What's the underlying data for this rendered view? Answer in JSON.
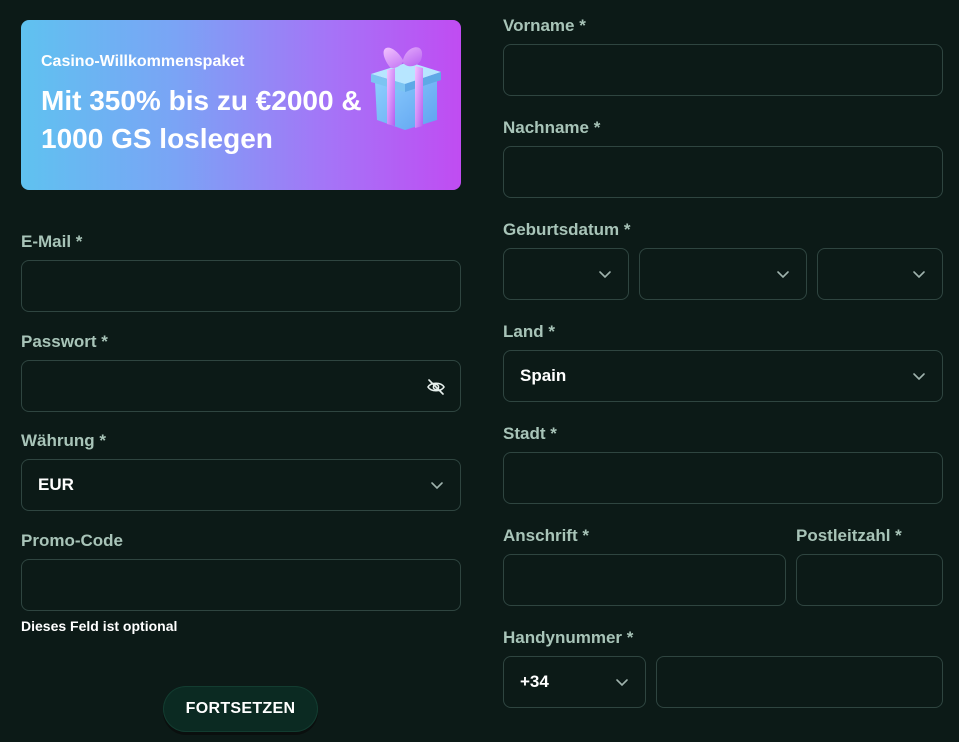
{
  "banner": {
    "subtitle": "Casino-Willkommenspaket",
    "title": "Mit 350% bis zu €2000 & 1000 GS loslegen"
  },
  "left": {
    "email_label": "E-Mail *",
    "email_value": "",
    "password_label": "Passwort *",
    "password_value": "",
    "currency_label": "Währung *",
    "currency_value": "EUR",
    "promo_label": "Promo-Code",
    "promo_value": "",
    "promo_hint": "Dieses Feld ist optional",
    "submit_label": "FORTSETZEN"
  },
  "right": {
    "firstname_label": "Vorname *",
    "firstname_value": "",
    "lastname_label": "Nachname *",
    "lastname_value": "",
    "birthdate_label": "Geburtsdatum *",
    "birthdate_day": "",
    "birthdate_month": "",
    "birthdate_year": "",
    "country_label": "Land *",
    "country_value": "Spain",
    "city_label": "Stadt *",
    "city_value": "",
    "address_label": "Anschrift *",
    "address_value": "",
    "zip_label": "Postleitzahl *",
    "zip_value": "",
    "phone_label": "Handynummer *",
    "phone_code": "+34",
    "phone_value": ""
  },
  "icons": {
    "chevron": "chevron-down-icon",
    "eye": "eye-off-icon",
    "gift": "gift-icon"
  },
  "colors": {
    "background": "#0c1a17",
    "label": "#a8c4b8",
    "border": "#2f4540",
    "button": "#0b2a22"
  }
}
